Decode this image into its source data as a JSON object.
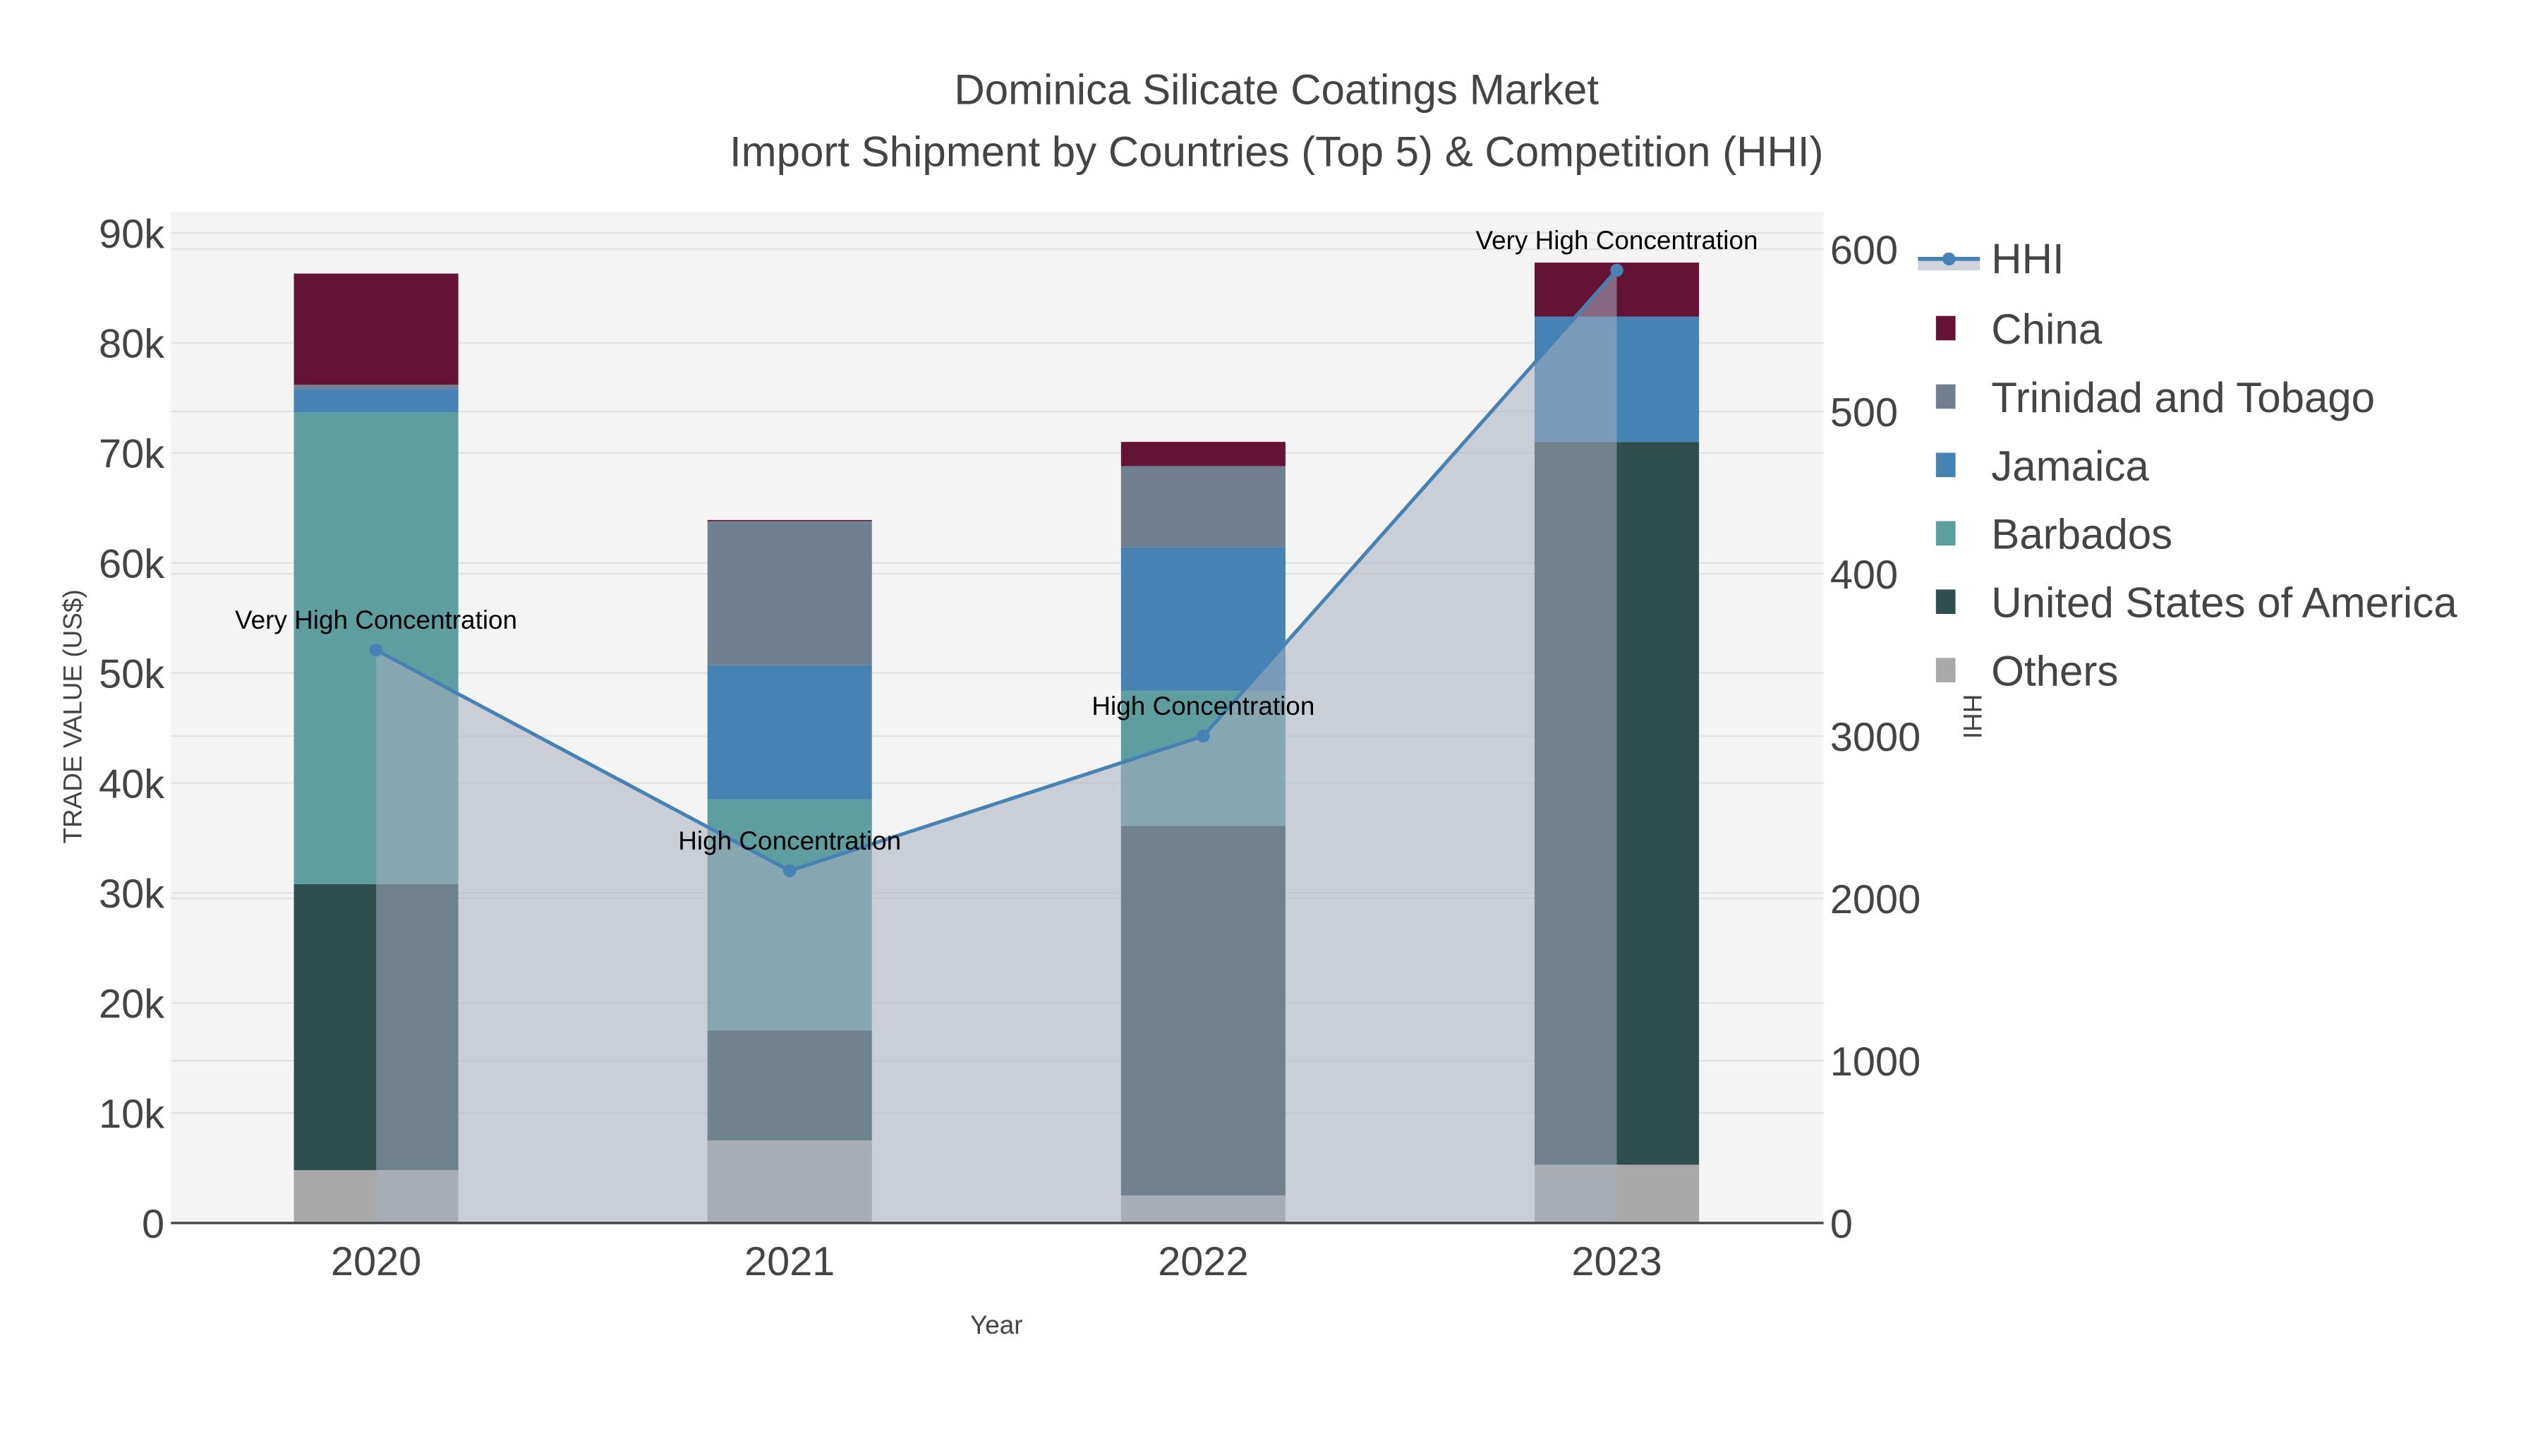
{
  "chart_data": {
    "type": "bar",
    "stacked": true,
    "title": "Dominica Silicate Coatings Market",
    "subtitle": "Import Shipment by Countries (Top 5) & Competition (HHI)",
    "xlabel": "Year",
    "ylabel": "TRADE VALUE (US$)",
    "y2label": "HHI",
    "categories": [
      "2020",
      "2021",
      "2022",
      "2023"
    ],
    "ylim": [
      0,
      92000
    ],
    "yticks": [
      0,
      10000,
      20000,
      30000,
      40000,
      50000,
      60000,
      70000,
      80000,
      90000
    ],
    "ytick_labels": [
      "0",
      "10k",
      "20k",
      "30k",
      "40k",
      "50k",
      "60k",
      "70k",
      "80k",
      "90k"
    ],
    "y2lim": [
      0,
      6200
    ],
    "y2ticks": [
      0,
      1000,
      2000,
      3000,
      4000,
      5000,
      6000
    ],
    "y2tick_labels": [
      "0",
      "1000",
      "2000",
      "3000",
      "400",
      "500",
      "600"
    ],
    "series": [
      {
        "name": "Others",
        "color": "#a9a9a9",
        "values": [
          4800,
          7500,
          2500,
          5300
        ]
      },
      {
        "name": "United States of America",
        "color": "#2f4f4f",
        "values": [
          26000,
          10000,
          33600,
          65700
        ]
      },
      {
        "name": "Barbados",
        "color": "#5f9ea0",
        "values": [
          42900,
          21000,
          12300,
          0
        ]
      },
      {
        "name": "Jamaica",
        "color": "#4682b4",
        "values": [
          2100,
          12200,
          13000,
          11400
        ]
      },
      {
        "name": "Trinidad and Tobago",
        "color": "#708090",
        "values": [
          400,
          13100,
          7400,
          0
        ]
      },
      {
        "name": "China",
        "color": "#641334",
        "values": [
          10100,
          100,
          2200,
          4900
        ]
      }
    ],
    "hhi": {
      "name": "HHI",
      "color": "#4682b4",
      "values": [
        3530,
        2170,
        3000,
        5870
      ],
      "annotations": [
        "Very High Concentration",
        "High Concentration",
        "High Concentration",
        "Very High Concentration"
      ]
    },
    "legend": {
      "placement": "right",
      "entries": [
        "HHI",
        "China",
        "Trinidad and Tobago",
        "Jamaica",
        "Barbados",
        "United States of America",
        "Others"
      ]
    },
    "grid": true
  }
}
